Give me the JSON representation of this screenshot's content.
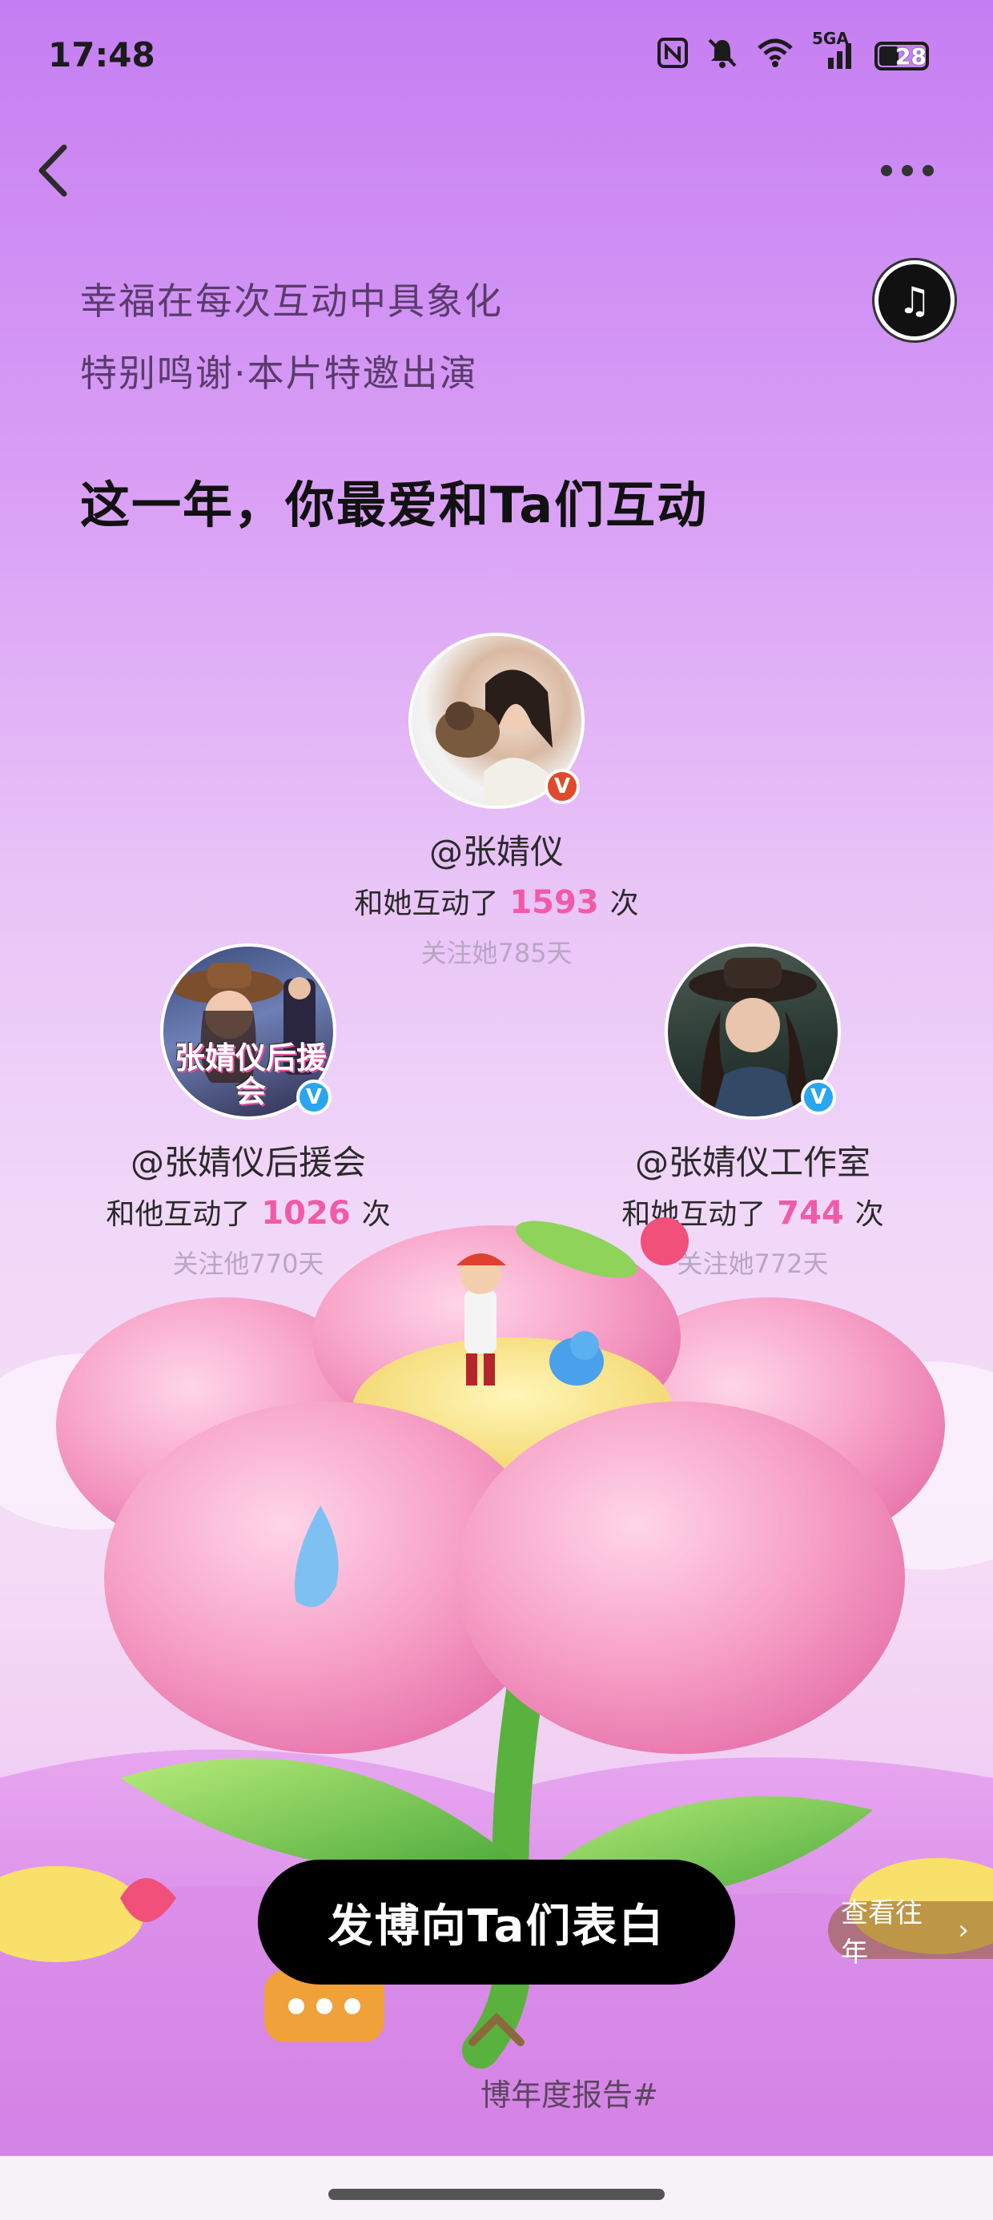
{
  "status_bar": {
    "time": "17:48",
    "icons": [
      "nfc-icon",
      "mute-icon",
      "wifi-icon",
      "signal-5ga-icon",
      "battery-icon"
    ],
    "network": "5GA",
    "battery": "28"
  },
  "nav": {
    "back_icon": "chevron-left-icon",
    "more_icon": "more-dots-icon"
  },
  "header": {
    "line1": "幸福在每次互动中具象化",
    "line2": "特别鸣谢·本片特邀出演",
    "title": "这一年，你最爱和Ta们互动",
    "music_icon": "music-note-icon"
  },
  "people": [
    {
      "name": "@张婧仪",
      "prefix": "和她互动了",
      "count": "1593",
      "suffix": "次",
      "days": "关注她785天",
      "badge": "V",
      "badge_color": "#e0492b"
    },
    {
      "name": "@张婧仪后援会",
      "prefix": "和他互动了",
      "count": "1026",
      "suffix": "次",
      "days": "关注他770天",
      "badge": "V",
      "badge_color": "#2aa6ef",
      "avatar_text": "张婧仪后援会"
    },
    {
      "name": "@张婧仪工作室",
      "prefix": "和她互动了",
      "count": "744",
      "suffix": "次",
      "days": "关注她772天",
      "badge": "V",
      "badge_color": "#2aa6ef"
    }
  ],
  "actions": {
    "cta": "发博向Ta们表白",
    "past": "查看往年"
  },
  "footer": {
    "hashtag": "博年度报告#"
  },
  "colors": {
    "count_accent": "#f15aa8",
    "flower_pink": "#f7a2c8",
    "leaf_green": "#6cc04a"
  }
}
